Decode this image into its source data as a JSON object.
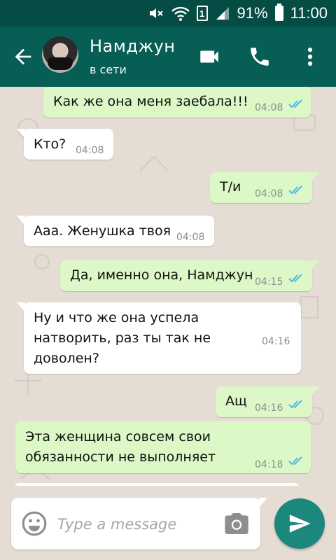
{
  "status_bar": {
    "battery": "91%",
    "time": "11:00",
    "sim": "1"
  },
  "header": {
    "contact_name": "Намджун",
    "contact_status": "в сети"
  },
  "messages": [
    {
      "direction": "out",
      "text": "Как же она меня заебала!!!",
      "time": "04:08",
      "read": true
    },
    {
      "direction": "in",
      "text": "Кто?",
      "time": "04:08"
    },
    {
      "direction": "out",
      "text": "Т/и",
      "time": "04:08",
      "read": true
    },
    {
      "direction": "in",
      "text": "Ааа. Женушка твоя",
      "time": "04:08"
    },
    {
      "direction": "out",
      "text": "Да, именно она, Намджун",
      "time": "04:15",
      "read": true
    },
    {
      "direction": "in",
      "lines": [
        "Ну и что же она успела",
        "натворить, раз ты так не",
        "доволен?"
      ],
      "time": "04:16"
    },
    {
      "direction": "out",
      "text": "Ащ",
      "time": "04:16",
      "read": true
    },
    {
      "direction": "out",
      "lines": [
        "Эта женщина совсем свои",
        "обязанности не выполняет"
      ],
      "time": "04:18",
      "read": true
    }
  ],
  "composer": {
    "placeholder": "Type a message"
  },
  "colors": {
    "status_bar": "#054d44",
    "app_bar": "#075e54",
    "outgoing_bubble": "#dcf8c6",
    "incoming_bubble": "#ffffff",
    "read_tick": "#4fb6ec",
    "send_button": "#1c877d"
  },
  "icons": [
    "mute-icon",
    "wifi-icon",
    "signal-icon",
    "battery-icon",
    "back-arrow-icon",
    "video-call-icon",
    "phone-icon",
    "more-vert-icon",
    "emoji-icon",
    "camera-icon",
    "send-icon",
    "double-check-icon"
  ]
}
